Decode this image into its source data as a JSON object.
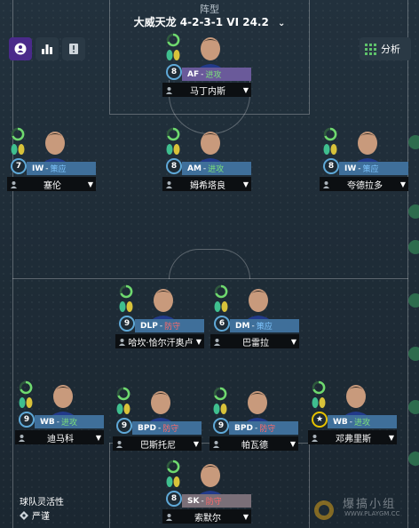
{
  "header": {
    "label": "阵型",
    "formation": "大威天龙 4-2-3-1 VI  24.2"
  },
  "toolbar": {
    "analysis_label": "分析"
  },
  "players": [
    {
      "key": "af",
      "number": "8",
      "role": "AF",
      "duty": "进攻",
      "duty_type": "attack",
      "name": "马丁内斯",
      "number_style": "blue"
    },
    {
      "key": "iwl",
      "number": "7",
      "role": "IW",
      "duty": "策应",
      "duty_type": "support",
      "name": "塞伦",
      "number_style": "blue"
    },
    {
      "key": "am",
      "number": "8",
      "role": "AM",
      "duty": "进攻",
      "duty_type": "attack",
      "name": "姆希塔良",
      "number_style": "blue"
    },
    {
      "key": "iwr",
      "number": "8",
      "role": "IW",
      "duty": "策应",
      "duty_type": "support",
      "name": "夸德拉多",
      "number_style": "blue"
    },
    {
      "key": "dlp",
      "number": "9",
      "role": "DLP",
      "duty": "防守",
      "duty_type": "defend",
      "name": "哈坎·恰尔汗奥卢",
      "number_style": "blue"
    },
    {
      "key": "dm",
      "number": "6",
      "role": "DM",
      "duty": "策应",
      "duty_type": "support",
      "name": "巴雷拉",
      "number_style": "blue"
    },
    {
      "key": "wbl",
      "number": "9",
      "role": "WB",
      "duty": "进攻",
      "duty_type": "attack",
      "name": "迪马科",
      "number_style": "blue"
    },
    {
      "key": "bpdl",
      "number": "9",
      "role": "BPD",
      "duty": "防守",
      "duty_type": "defend",
      "name": "巴斯托尼",
      "number_style": "blue"
    },
    {
      "key": "bpdr",
      "number": "9",
      "role": "BPD",
      "duty": "防守",
      "duty_type": "defend",
      "name": "帕瓦德",
      "number_style": "blue"
    },
    {
      "key": "wbr",
      "number": "★",
      "role": "WB",
      "duty": "进攻",
      "duty_type": "attack",
      "name": "邓弗里斯",
      "number_style": "gold"
    },
    {
      "key": "sk",
      "number": "8",
      "role": "SK",
      "duty": "防守",
      "duty_type": "defend",
      "name": "索默尔",
      "number_style": "blue"
    }
  ],
  "team": {
    "flex_label": "球队灵活性",
    "flex_value": "严谨"
  },
  "watermark": {
    "text": "爆搞小组",
    "url": "WWW.PLAYGM.CC"
  },
  "colors": {
    "attack": "#7be07b",
    "support": "#7fc6ff",
    "defend": "#ff6a6a",
    "accent": "#4a2a8a"
  }
}
